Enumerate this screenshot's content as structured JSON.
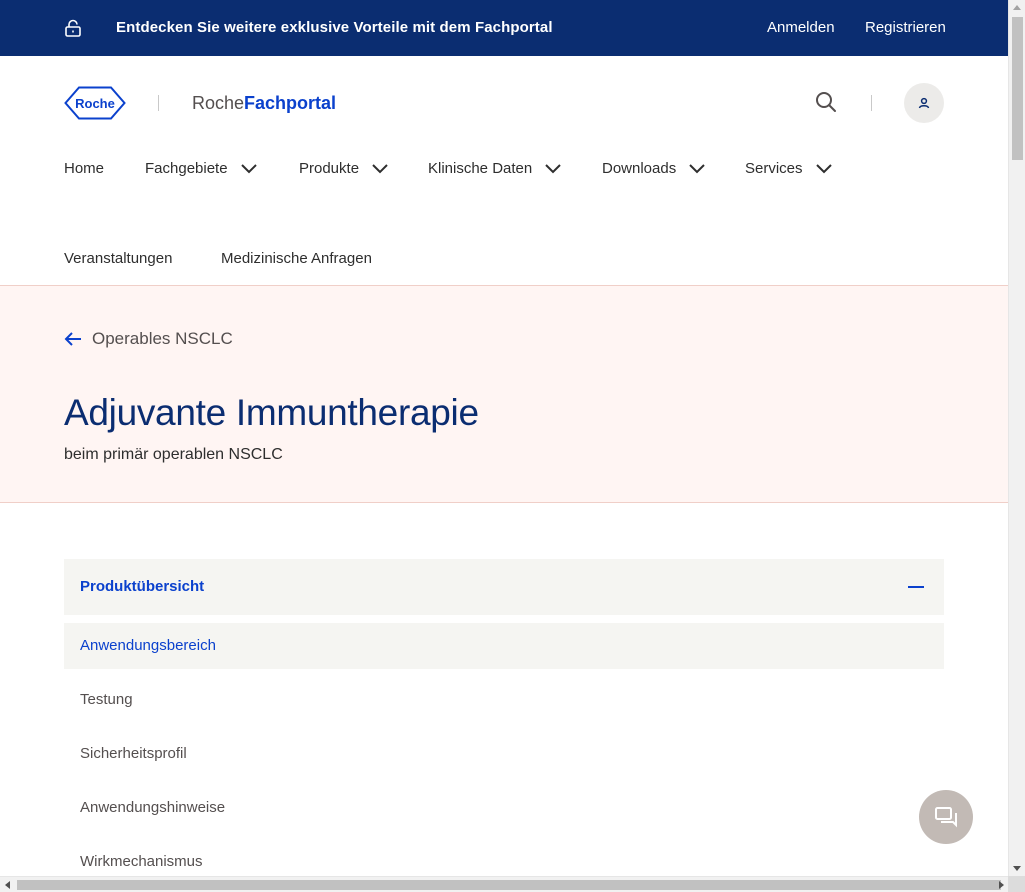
{
  "colors": {
    "brand_navy": "#0b2d71",
    "brand_blue": "#0b41cd",
    "hero_bg": "#fff5f3",
    "accordion_bg": "#f5f5f2"
  },
  "topbar": {
    "lock_icon": "lock-icon",
    "promo_text": "Entdecken Sie weitere exklusive Vorteile mit dem Fachportal",
    "login_label": "Anmelden",
    "register_label": "Registrieren"
  },
  "header": {
    "logo_text": "Roche",
    "portal_prefix": "Roche",
    "portal_name": "Fachportal",
    "search_icon": "search-icon",
    "user_icon": "user-icon"
  },
  "nav": {
    "items": [
      {
        "label": "Home",
        "dropdown": false
      },
      {
        "label": "Fachgebiete",
        "dropdown": true
      },
      {
        "label": "Produkte",
        "dropdown": true
      },
      {
        "label": "Klinische Daten",
        "dropdown": true
      },
      {
        "label": "Downloads",
        "dropdown": true
      },
      {
        "label": "Services",
        "dropdown": true
      },
      {
        "label": "Veranstaltungen",
        "dropdown": false
      },
      {
        "label": "Medizinische Anfragen",
        "dropdown": false
      }
    ]
  },
  "hero": {
    "back_label": "Operables NSCLC",
    "title": "Adjuvante Immuntherapie",
    "subtitle": "beim primär operablen NSCLC"
  },
  "accordion": {
    "title": "Produktübersicht",
    "expanded": true,
    "items": [
      {
        "label": "Anwendungsbereich",
        "active": true
      },
      {
        "label": "Testung",
        "active": false
      },
      {
        "label": "Sicherheitsprofil",
        "active": false
      },
      {
        "label": "Anwendungshinweise",
        "active": false
      },
      {
        "label": "Wirkmechanismus",
        "active": false
      }
    ]
  },
  "chat": {
    "icon": "chat-icon"
  }
}
